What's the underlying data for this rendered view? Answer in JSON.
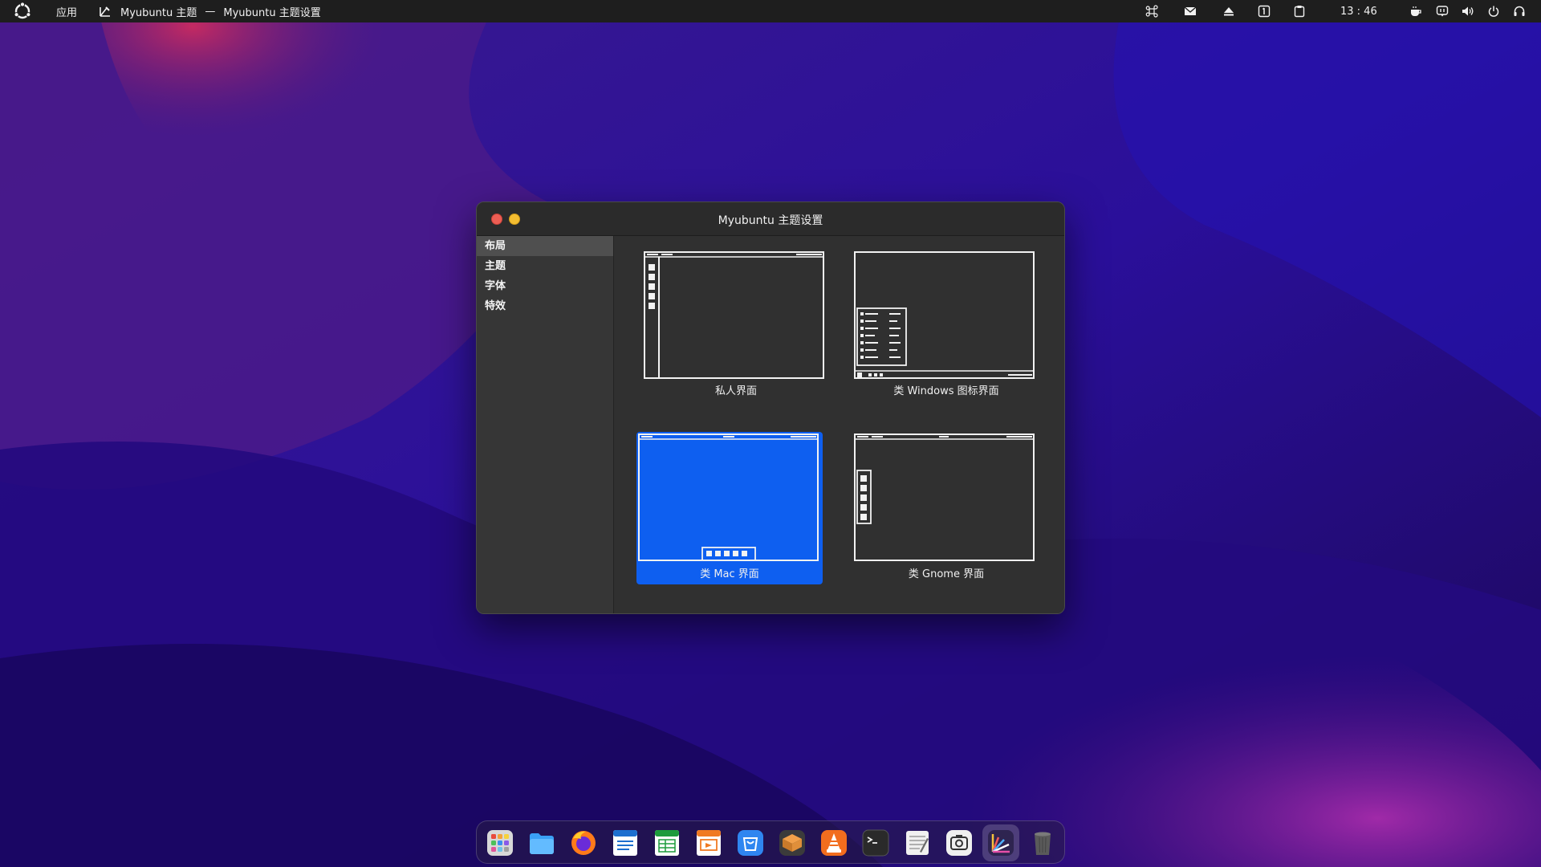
{
  "top_panel": {
    "apps_label": "应用",
    "active_app_name": "Myubuntu 主题",
    "separator": "—",
    "window_title": "Myubuntu 主题设置",
    "clock": "13 : 46"
  },
  "window": {
    "title": "Myubuntu 主题设置",
    "sidebar": {
      "items": [
        {
          "label": "布局",
          "active": true
        },
        {
          "label": "主题",
          "active": false
        },
        {
          "label": "字体",
          "active": false
        },
        {
          "label": "特效",
          "active": false
        }
      ]
    },
    "layouts": [
      {
        "label": "私人界面",
        "selected": false
      },
      {
        "label": "类 Windows 图标界面",
        "selected": false
      },
      {
        "label": "类 Mac 界面",
        "selected": true
      },
      {
        "label": "类 Gnome 界面",
        "selected": false
      }
    ]
  },
  "dock": {
    "apps": [
      "launchpad-icon",
      "files-icon",
      "firefox-icon",
      "writer-icon",
      "calc-icon",
      "impress-icon",
      "software-store-icon",
      "package-manager-icon",
      "vlc-icon",
      "terminal-icon",
      "text-editor-icon",
      "screenshot-icon",
      "theme-settings-icon",
      "trash-icon"
    ]
  },
  "colors": {
    "selection_blue": "#0e5ff0",
    "close": "#ec5e54",
    "minimize": "#f3bd31"
  }
}
